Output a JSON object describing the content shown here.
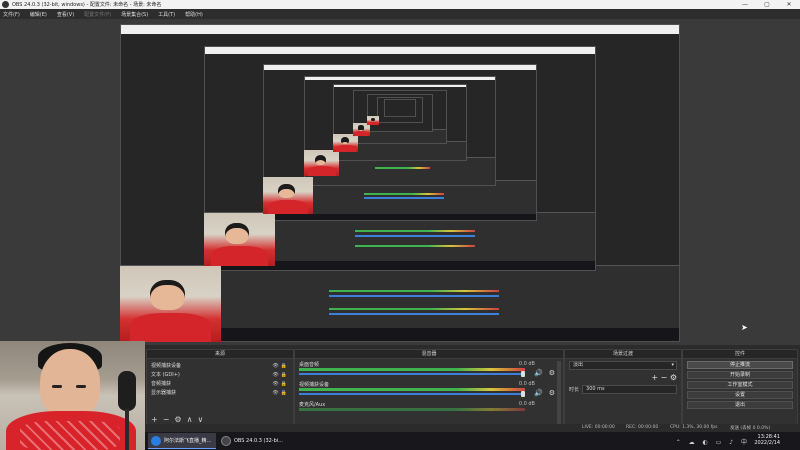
{
  "window": {
    "title": "OBS 24.0.3 (32-bit, windows) - 配置文件: 未命名 - 场景: 未命名",
    "controls": [
      "—",
      "▢",
      "✕"
    ]
  },
  "menu": {
    "items": [
      {
        "label": "文件(F)",
        "enabled": true
      },
      {
        "label": "编辑(E)",
        "enabled": true
      },
      {
        "label": "查看(V)",
        "enabled": true
      },
      {
        "label": "配置文件(P)",
        "enabled": false
      },
      {
        "label": "场景集合(S)",
        "enabled": true
      },
      {
        "label": "工具(T)",
        "enabled": true
      },
      {
        "label": "帮助(H)",
        "enabled": true
      }
    ]
  },
  "docks": {
    "sources": {
      "title": "来源",
      "items": [
        "视频捕获设备",
        "文本 (GDI+)",
        "音频捕获",
        "显示器捕获"
      ],
      "tools": [
        "+",
        "−",
        "⚙",
        "∧",
        "∨"
      ]
    },
    "mixer": {
      "title": "混音器",
      "channels": [
        {
          "name": "桌面音频",
          "db": "0.0 dB"
        },
        {
          "name": "视频捕获设备",
          "db": "0.0 dB"
        },
        {
          "name": "麦克风/Aux",
          "db": "0.0 dB"
        }
      ]
    },
    "transitions": {
      "title": "场景过渡",
      "selected": "淡出",
      "duration_label": "时长",
      "duration_value": "300 ms",
      "tools": [
        "+",
        "−",
        "⚙"
      ]
    },
    "controls": {
      "title": "控件",
      "buttons": [
        {
          "label": "停止推流",
          "active": true
        },
        {
          "label": "开始录制",
          "active": false
        },
        {
          "label": "工作室模式",
          "active": false
        },
        {
          "label": "设置",
          "active": false
        },
        {
          "label": "退出",
          "active": false
        }
      ]
    }
  },
  "status": {
    "live": "LIVE: 00:00:00",
    "rec": "REC: 00:00:00",
    "cpu": "CPU: 1.3%, 30.00 fps",
    "extra": "发送 (丢帧 0 0.0%)"
  },
  "taskbar": {
    "apps": [
      {
        "label": "阿尔法斯飞直播_精..."
      },
      {
        "label": "OBS 24.0.3 (32-bi..."
      }
    ],
    "time": "13:28:41",
    "date": "2022/2/14",
    "tray_icons": "⌃ ☁ ◐ ▭ ♪ 中"
  },
  "colors": {
    "accent": "#3d7fd9",
    "meter_green": "#3fb34f",
    "meter_yellow": "#d6c53a",
    "meter_red": "#d04040",
    "background": "#2b2b2b"
  }
}
